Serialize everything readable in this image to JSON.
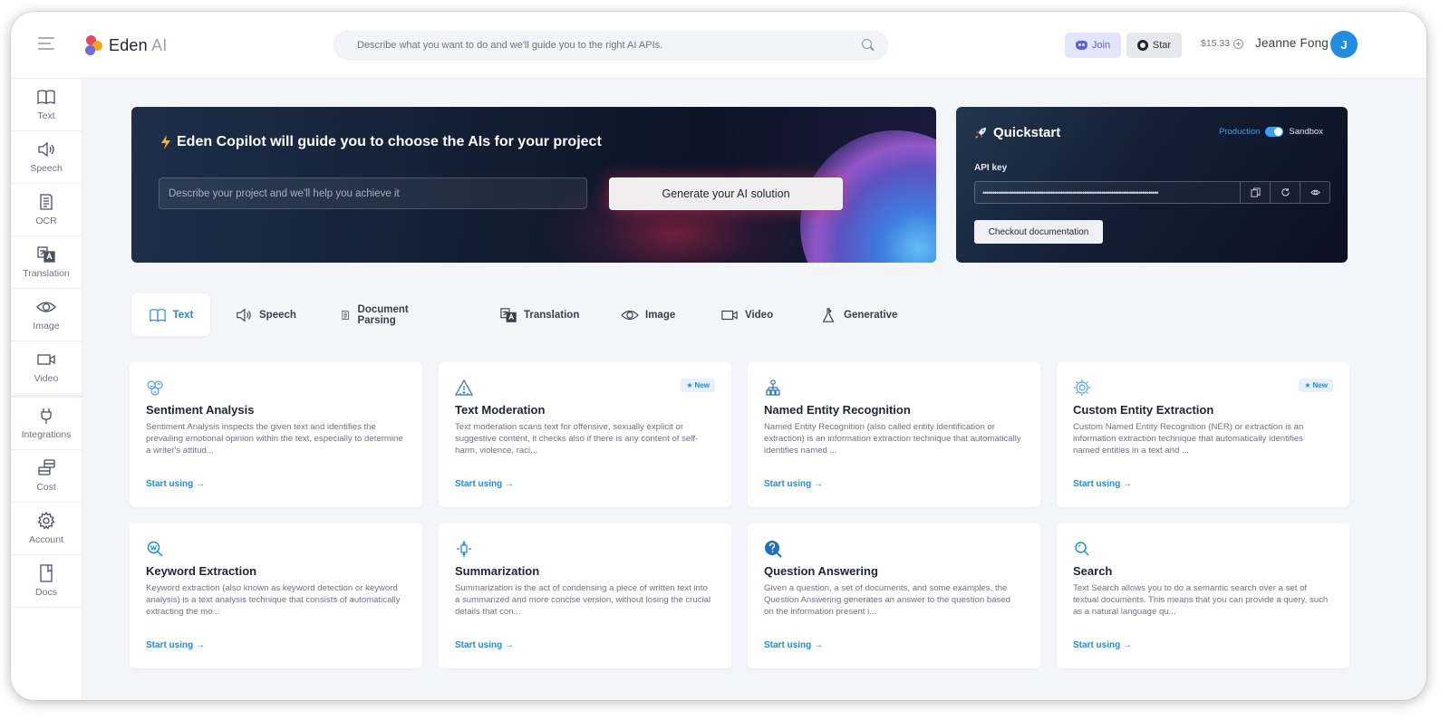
{
  "header": {
    "logo_name": "Eden",
    "logo_suffix": "AI",
    "search_placeholder": " Describe what you want to do and we'll guide you to the right AI APIs.",
    "join_label": "Join",
    "star_label": "Star",
    "balance": "$15.33",
    "user_name": "Jeanne Fong",
    "avatar_initial": "J"
  },
  "sidebar": {
    "items": [
      {
        "label": "Text",
        "icon": "book-icon"
      },
      {
        "label": "Speech",
        "icon": "speaker-icon"
      },
      {
        "label": "OCR",
        "icon": "document-icon"
      },
      {
        "label": "Translation",
        "icon": "translate-icon"
      },
      {
        "label": "Image",
        "icon": "eye-icon"
      },
      {
        "label": "Video",
        "icon": "video-icon"
      },
      {
        "label": "Integrations",
        "icon": "plug-icon"
      },
      {
        "label": "Cost",
        "icon": "coins-icon"
      },
      {
        "label": "Account",
        "icon": "gear-icon"
      },
      {
        "label": "Docs",
        "icon": "doc-icon"
      }
    ]
  },
  "hero": {
    "title": "Eden Copilot will guide you to choose the AIs for your project",
    "input_placeholder": "Describe your project and we'll help you achieve it",
    "button_label": "Generate your AI solution"
  },
  "quickstart": {
    "title": "Quickstart",
    "env_production": "Production",
    "env_sandbox": "Sandbox",
    "api_key_label": "API key",
    "api_key_value": "••••••••••••••••••••••••••••••••••••••••••••••••••••••••••••••••••••••••••••••••••••••••••",
    "doc_button": "Checkout documentation"
  },
  "tabs": [
    {
      "label": "Text",
      "icon": "book-icon",
      "active": true
    },
    {
      "label": "Speech",
      "icon": "speaker-icon"
    },
    {
      "label": "Document Parsing",
      "icon": "document-icon"
    },
    {
      "label": "Translation",
      "icon": "translate-icon"
    },
    {
      "label": "Image",
      "icon": "eye-icon"
    },
    {
      "label": "Video",
      "icon": "video-icon"
    },
    {
      "label": "Generative",
      "icon": "flask-icon"
    }
  ],
  "cards": [
    {
      "title": "Sentiment Analysis",
      "icon": "faces-icon",
      "badge": "",
      "desc": "Sentiment Analysis inspects the given text and identifies the prevailing emotional opinion within the text, especially to determine a writer's attitud...",
      "link": "Start using →"
    },
    {
      "title": "Text Moderation",
      "icon": "warning-icon",
      "badge": "New",
      "desc": "Text moderation scans text for offensive, sexually explicit or suggestive content, it checks also if there is any content of self-harm, violence, raci...",
      "link": "Start using →"
    },
    {
      "title": "Named Entity Recognition",
      "icon": "entities-icon",
      "badge": "",
      "desc": "Named Entity Recognition (also called entity identification or extraction) is an information extraction technique that automatically identifies named ...",
      "link": "Start using →"
    },
    {
      "title": "Custom Entity Extraction",
      "icon": "gear-icon",
      "badge": "New",
      "desc": "Custom Named Entity Recognition (NER) or extraction is an information extraction technique that automatically identifies named entities in a text and ...",
      "link": "Start using →"
    },
    {
      "title": "Keyword Extraction",
      "icon": "keyword-search-icon",
      "badge": "",
      "desc": "Keyword extraction (also known as keyword detection or keyword analysis) is a text analysis technique that consists of automatically extracting the mo...",
      "link": "Start using →"
    },
    {
      "title": "Summarization",
      "icon": "compress-icon",
      "badge": "",
      "desc": "Summarization is the act of condensing a piece of written text into a summarized and more concise version, without losing the crucial details that con...",
      "link": "Start using →"
    },
    {
      "title": "Question Answering",
      "icon": "question-icon",
      "badge": "",
      "desc": "Given a question, a set of documents, and some examples, the Question Answering generates an answer to the question based on the information present i...",
      "link": "Start using →"
    },
    {
      "title": "Search",
      "icon": "search-icon",
      "badge": "",
      "desc": "Text Search allows you to do a semantic search over a set of textual documents. This means that you can provide a query, such as a natural language qu...",
      "link": "Start using →"
    }
  ],
  "colors": {
    "accent": "#1f8de0",
    "hero_dark": "#0d1426",
    "page_bg": "#f4f5f8"
  }
}
